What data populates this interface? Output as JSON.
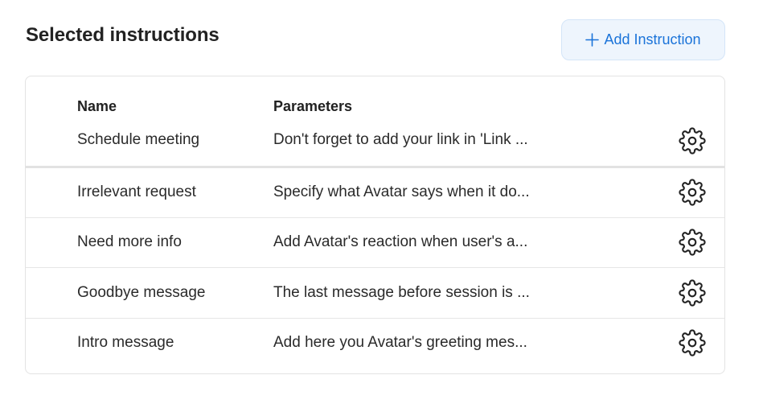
{
  "header": {
    "title": "Selected instructions",
    "add_button_label": "Add Instruction"
  },
  "table": {
    "columns": {
      "name": "Name",
      "parameters": "Parameters"
    },
    "rows": [
      {
        "name": "Schedule meeting",
        "parameters": "Don't forget to add your link in 'Link ..."
      },
      {
        "name": "Irrelevant request",
        "parameters": "Specify what Avatar says when it do..."
      },
      {
        "name": "Need more info",
        "parameters": "Add Avatar's reaction when user's a..."
      },
      {
        "name": "Goodbye message",
        "parameters": "The last message before session is ..."
      },
      {
        "name": "Intro message",
        "parameters": "Add here you Avatar's greeting mes..."
      }
    ]
  },
  "icons": {
    "add": "plus-icon",
    "row_action": "gear-icon"
  },
  "colors": {
    "accent": "#1a73d9",
    "button_bg": "#eef5fd",
    "border": "#e3e3e3"
  }
}
